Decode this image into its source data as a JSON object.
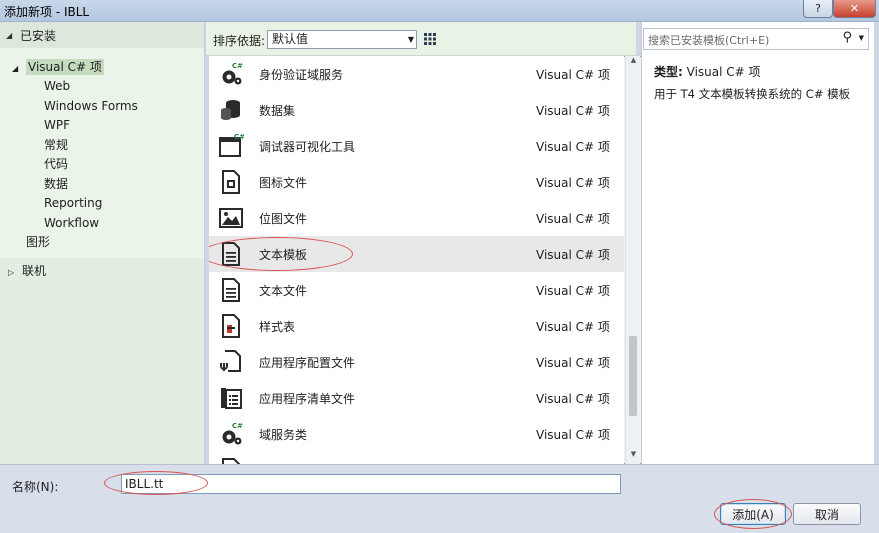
{
  "window": {
    "title": "添加新项 - IBLL",
    "help_label": "?",
    "close_label": "✕"
  },
  "left": {
    "installed_label": "已安装",
    "tree": [
      {
        "label": "Visual C# 项",
        "level": 1,
        "expanded": true,
        "selected": true
      },
      {
        "label": "Web",
        "level": 2
      },
      {
        "label": "Windows Forms",
        "level": 2
      },
      {
        "label": "WPF",
        "level": 2
      },
      {
        "label": "常规",
        "level": 2
      },
      {
        "label": "代码",
        "level": 2
      },
      {
        "label": "数据",
        "level": 2
      },
      {
        "label": "Reporting",
        "level": 2
      },
      {
        "label": "Workflow",
        "level": 2
      },
      {
        "label": "图形",
        "level": 1
      }
    ],
    "online_label": "联机"
  },
  "toolbar": {
    "sort_label": "排序依据:",
    "sort_value": "默认值"
  },
  "items": [
    {
      "name": "身份验证域服务",
      "type": "Visual C# 项",
      "icon": "domain-service-icon"
    },
    {
      "name": "数据集",
      "type": "Visual C# 项",
      "icon": "dataset-icon"
    },
    {
      "name": "调试器可视化工具",
      "type": "Visual C# 项",
      "icon": "debugger-visualizer-icon"
    },
    {
      "name": "图标文件",
      "type": "Visual C# 项",
      "icon": "icon-file-icon"
    },
    {
      "name": "位图文件",
      "type": "Visual C# 项",
      "icon": "bitmap-icon"
    },
    {
      "name": "文本模板",
      "type": "Visual C# 项",
      "icon": "text-template-icon",
      "highlighted": true
    },
    {
      "name": "文本文件",
      "type": "Visual C# 项",
      "icon": "text-file-icon"
    },
    {
      "name": "样式表",
      "type": "Visual C# 项",
      "icon": "stylesheet-icon"
    },
    {
      "name": "应用程序配置文件",
      "type": "Visual C# 项",
      "icon": "config-file-icon"
    },
    {
      "name": "应用程序清单文件",
      "type": "Visual C# 项",
      "icon": "manifest-icon"
    },
    {
      "name": "域服务类",
      "type": "Visual C# 项",
      "icon": "domain-service-class-icon"
    }
  ],
  "right": {
    "search_placeholder": "搜索已安装模板(Ctrl+E)",
    "type_label": "类型:",
    "type_value": "Visual C# 项",
    "description": "用于 T4 文本模板转换系统的 C# 模板"
  },
  "bottom": {
    "name_label": "名称(N):",
    "name_value": "IBLL.tt",
    "add_label": "添加(A)",
    "cancel_label": "取消"
  },
  "colors": {
    "annotation": "#d9534f",
    "selection_green": "#c5dcbf"
  }
}
